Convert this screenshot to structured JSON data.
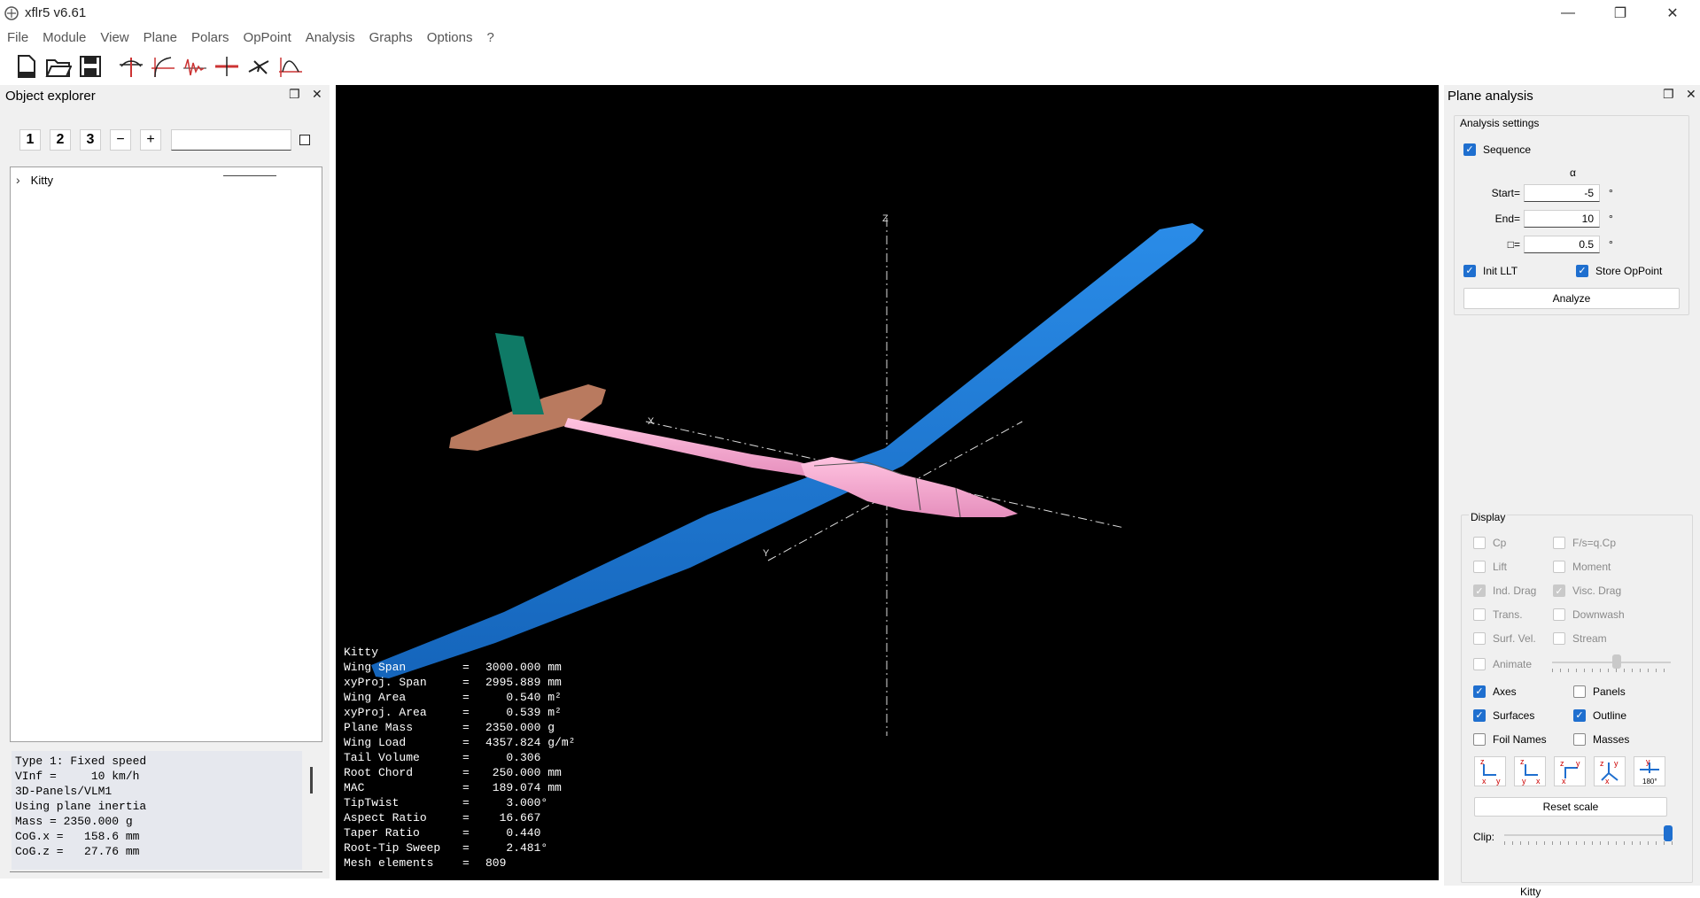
{
  "app": {
    "title": "xflr5 v6.61",
    "icon": "xflr5-logo-icon"
  },
  "window_controls": {
    "minimize": "—",
    "restore": "❐",
    "close": "✕"
  },
  "menu": [
    "File",
    "Module",
    "View",
    "Plane",
    "Polars",
    "OpPoint",
    "Analysis",
    "Graphs",
    "Options",
    "?"
  ],
  "toolbar_icons": [
    "new-project-icon",
    "open-project-icon",
    "save-project-icon",
    "wopp-view-icon",
    "wpolar-view-icon",
    "stab-view-icon",
    "cp-view-icon",
    "3d-view-icon",
    "xfoil-analysis-icon"
  ],
  "object_explorer": {
    "title": "Object explorer",
    "level_buttons": [
      "1",
      "2",
      "3"
    ],
    "collapse_label": "−",
    "expand_label": "+",
    "filter_value": "",
    "tree": [
      {
        "label": "Kitty",
        "expander": "›"
      }
    ],
    "info_lines": [
      "Type 1: Fixed speed",
      "VInf =     10 km/h",
      "3D-Panels/VLM1",
      "Using plane inertia",
      "Mass = 2350.000 g",
      "CoG.x =   158.6 mm",
      "CoG.z =   27.76 mm"
    ]
  },
  "viewport": {
    "plane_name": "Kitty",
    "axis_labels": {
      "x": "X",
      "y": "Y",
      "z": "Z"
    },
    "colors": {
      "wing": "#1f7fdd",
      "fuselage": "#f3a8cf",
      "elevator": "#b97a5f",
      "fin": "#0f7a66",
      "background": "#000000"
    },
    "data": [
      {
        "label": "Wing Span",
        "eq": "=",
        "value": "3000.000 mm"
      },
      {
        "label": "xyProj. Span",
        "eq": "=",
        "value": "2995.889 mm"
      },
      {
        "label": "Wing Area",
        "eq": "=",
        "value": "   0.540 m²"
      },
      {
        "label": "xyProj. Area",
        "eq": "=",
        "value": "   0.539 m²"
      },
      {
        "label": "Plane Mass",
        "eq": "=",
        "value": "2350.000 g"
      },
      {
        "label": "Wing Load",
        "eq": "=",
        "value": "4357.824 g/m²"
      },
      {
        "label": "Tail Volume",
        "eq": "=",
        "value": "   0.306"
      },
      {
        "label": "Root Chord",
        "eq": "=",
        "value": " 250.000 mm"
      },
      {
        "label": "MAC",
        "eq": "=",
        "value": " 189.074 mm"
      },
      {
        "label": "TipTwist",
        "eq": "=",
        "value": "   3.000°"
      },
      {
        "label": "Aspect Ratio",
        "eq": "=",
        "value": "  16.667"
      },
      {
        "label": "Taper Ratio",
        "eq": "=",
        "value": "   0.440"
      },
      {
        "label": "Root-Tip Sweep",
        "eq": "=",
        "value": "   2.481°"
      },
      {
        "label": "Mesh elements",
        "eq": "=",
        "value": "809"
      }
    ]
  },
  "plane_analysis": {
    "title": "Plane analysis",
    "settings_label": "Analysis settings",
    "sequence_label": "Sequence",
    "variable": "α",
    "start_label": "Start=",
    "start_value": "-5",
    "end_label": "End=",
    "end_value": "10",
    "step_label": "□=",
    "step_value": "0.5",
    "unit": "°",
    "init_llt": "Init LLT",
    "store_opp": "Store OpPoint",
    "analyze_label": "Analyze",
    "display_label": "Display",
    "display_options": {
      "cp": "Cp",
      "fsqcp": "F/s=q.Cp",
      "lift": "Lift",
      "moment": "Moment",
      "ind_drag": "Ind. Drag",
      "visc_drag": "Visc. Drag",
      "trans": "Trans.",
      "downwash": "Downwash",
      "surf_vel": "Surf. Vel.",
      "stream": "Stream",
      "animate": "Animate",
      "axes": "Axes",
      "panels": "Panels",
      "surfaces": "Surfaces",
      "outline": "Outline",
      "foil_names": "Foil Names",
      "masses": "Masses"
    },
    "view_buttons": [
      "xy-view-icon",
      "yx-view-icon",
      "xz-view-icon",
      "iso-view-icon",
      "flip-180-view-icon"
    ],
    "reset_scale": "Reset scale",
    "clip_label": "Clip:",
    "clip_value": 1.0,
    "animate_speed": 0.55
  },
  "status": {
    "plane": "Kitty"
  }
}
